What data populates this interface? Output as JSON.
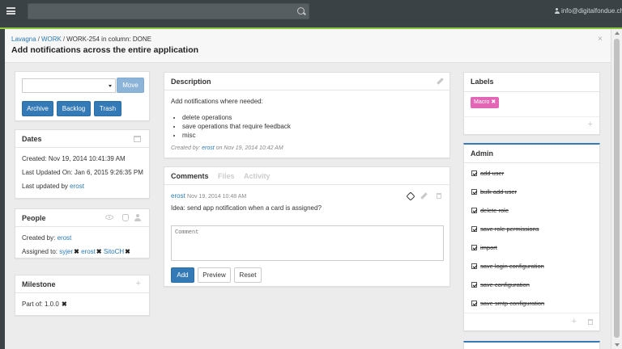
{
  "topbar": {
    "search_placeholder": "",
    "user_email": "info@digitalfondue.ch"
  },
  "modal": {
    "breadcrumb": {
      "project": "Lavagna",
      "board": "WORK",
      "card_info": "WORK-254 in column: DONE"
    },
    "title": "Add notifications across the entire application",
    "close_symbol": "×"
  },
  "actions": {
    "column_select_value": "",
    "move_label": "Move",
    "archive_label": "Archive",
    "backlog_label": "Backlog",
    "trash_label": "Trash"
  },
  "dates": {
    "title": "Dates",
    "created": "Created: Nov 19, 2014 10:41:39 AM",
    "last_updated_on": "Last Updated On: Jan 6, 2015 9:26:35 PM",
    "last_updated_by_prefix": "Last updated by",
    "last_updated_by_user": "erost"
  },
  "people": {
    "title": "People",
    "created_by_prefix": "Created by:",
    "created_by_user": "erost",
    "assigned_prefix": "Assigned to:",
    "assigned_users": [
      "syjer",
      "erost",
      "SitoCH"
    ],
    "remove_symbol": "✖"
  },
  "milestone": {
    "title": "Milestone",
    "part_of": "Part of: 1.0.0"
  },
  "description": {
    "title": "Description",
    "intro": "Add notifications where needed:",
    "items": [
      "delete operations",
      "save operations that require feedback",
      "misc"
    ],
    "created_by_prefix": "Created by:",
    "created_by_user": "erost",
    "created_on": "on Nov 19, 2014 10:42 AM"
  },
  "comments": {
    "tabs": [
      "Comments",
      "Files",
      "Activity"
    ],
    "comment": {
      "author": "erost",
      "timestamp": "Nov 19, 2014 10:48 AM",
      "text": "Idea: send app notification when a card is assigned?"
    },
    "input_placeholder": "Comment",
    "add_label": "Add",
    "preview_label": "Preview",
    "reset_label": "Reset"
  },
  "labels": {
    "title": "Labels",
    "tags": [
      {
        "name": "Macro",
        "color": "#e266b5"
      }
    ]
  },
  "admin": {
    "title": "Admin",
    "accent_color": "#337ab7",
    "permissions": [
      {
        "label": "add user",
        "checked": true
      },
      {
        "label": "bulk add user",
        "checked": true
      },
      {
        "label": "delete role",
        "checked": true
      },
      {
        "label": "save role permissions",
        "checked": true
      },
      {
        "label": "import",
        "checked": true
      },
      {
        "label": "save login configuration",
        "checked": true
      },
      {
        "label": "save configuration",
        "checked": true
      },
      {
        "label": "save smtp configuration",
        "checked": true
      }
    ]
  },
  "colors": {
    "topbar_bg": "#3a4246",
    "accent_green": "#8cc63f",
    "primary_button": "#337ab7",
    "link": "#2a7ab5"
  }
}
